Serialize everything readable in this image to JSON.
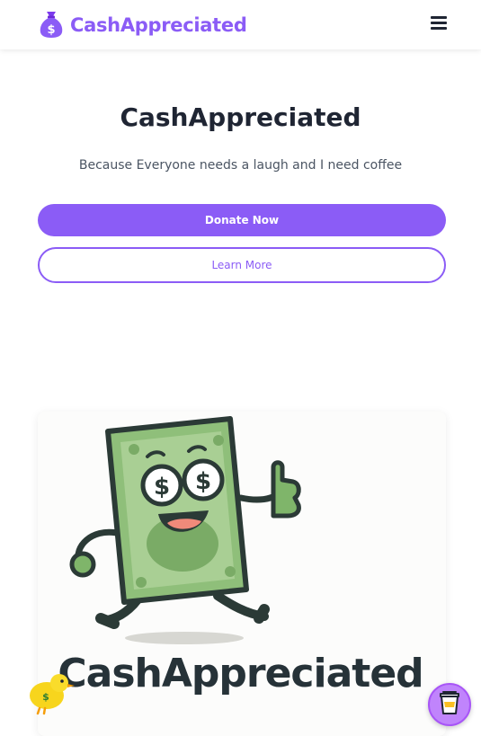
{
  "header": {
    "brand_name": "CashAppreciated",
    "logo_icon": "money-bag-icon",
    "menu_icon": "hamburger-menu-icon"
  },
  "hero": {
    "title": "CashAppreciated",
    "subtitle": "Because Everyone needs a laugh and I need coffee",
    "primary_button": "Donate Now",
    "secondary_button": "Learn More"
  },
  "logo_image": {
    "wordmark": "CashAppreciated",
    "mascot": "dollar-bill-mascot"
  },
  "floating": {
    "chick_icon": "chick-coin-icon",
    "coffee_icon": "coffee-cup-icon"
  },
  "colors": {
    "accent": "#8b5cf6",
    "text": "#1f2533",
    "bill_green": "#8fbf7a",
    "wordmark": "#263238"
  }
}
